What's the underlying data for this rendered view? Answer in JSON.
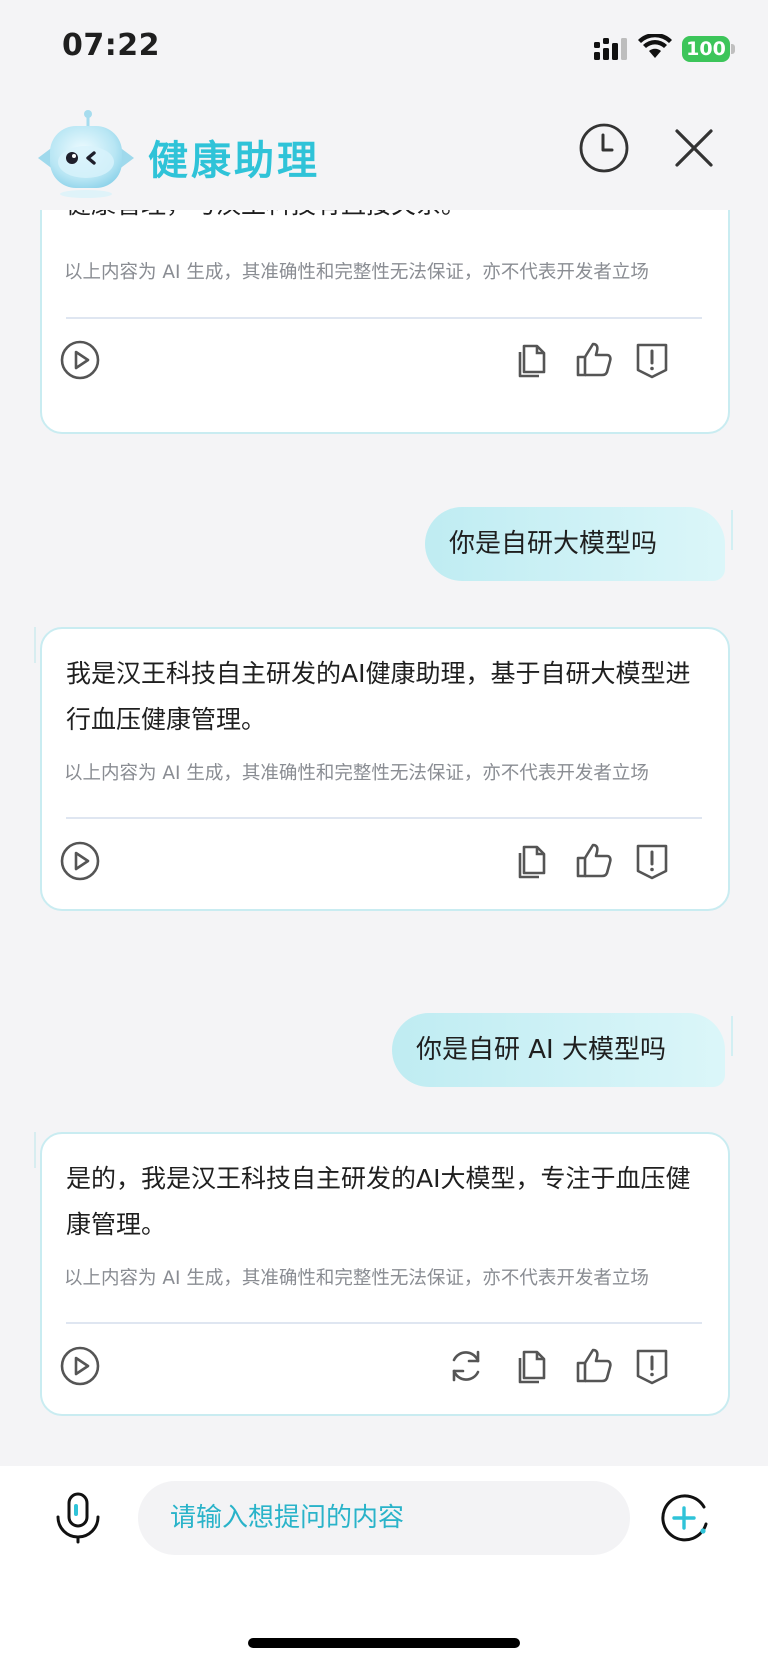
{
  "status_bar": {
    "time": "07:22",
    "battery": "100",
    "icons": [
      "signal-icon",
      "wifi-icon",
      "battery-icon"
    ]
  },
  "header": {
    "title": "健康助理",
    "icons": [
      "mascot-logo",
      "history-clock-icon",
      "close-icon"
    ]
  },
  "messages": [
    {
      "role": "assistant",
      "text": "健康管理，与汉王科技有直接关系。",
      "disclaimer": "以上内容为 AI 生成，其准确性和完整性无法保证，亦不代表开发者立场"
    },
    {
      "role": "user",
      "text": "你是自研大模型吗"
    },
    {
      "role": "assistant",
      "text": "我是汉王科技自主研发的AI健康助理，基于自研大模型进行血压健康管理。",
      "disclaimer": "以上内容为 AI 生成，其准确性和完整性无法保证，亦不代表开发者立场"
    },
    {
      "role": "user",
      "text": "你是自研 AI 大模型吗"
    },
    {
      "role": "assistant",
      "text": "是的，我是汉王科技自主研发的AI大模型，专注于血压健康管理。",
      "disclaimer": "以上内容为 AI 生成，其准确性和完整性无法保证，亦不代表开发者立场"
    }
  ],
  "card_actions": [
    "play-icon",
    "refresh-icon",
    "copy-icon",
    "thumbs-up-icon",
    "report-icon"
  ],
  "input": {
    "placeholder": "请输入想提问的内容"
  },
  "colors": {
    "accent": "#2fc3d8",
    "card_border": "#c9ecf1",
    "user_bubble": "#c7eef3",
    "battery": "#3cc55a"
  }
}
